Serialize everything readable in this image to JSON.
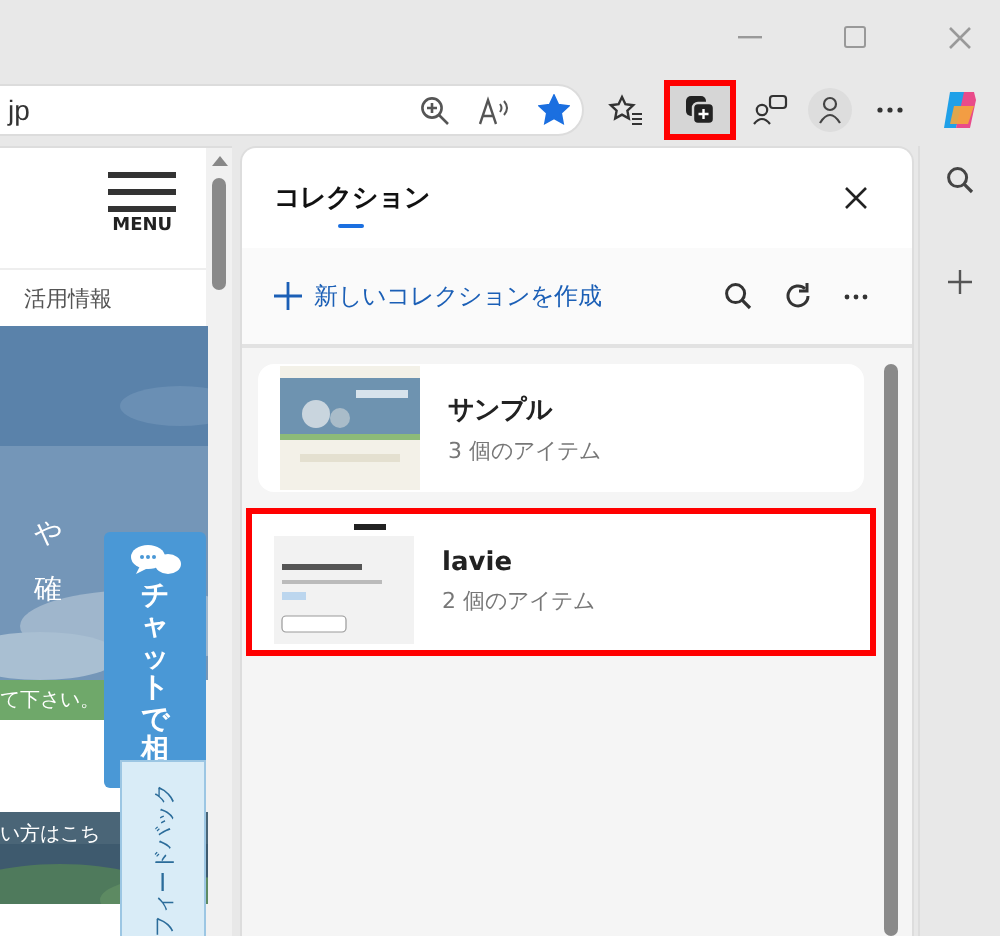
{
  "address_bar": {
    "url": "jp",
    "favorited": true
  },
  "toolbar": {
    "collections_highlighted": true
  },
  "web_page": {
    "menu_label": "MENU",
    "nav_item": "活用情報",
    "hero_lines": [
      "や",
      "確"
    ],
    "banner": "て下さい。",
    "link_band": "い方はこち",
    "chat_tab": "チャットで相",
    "feedback_tab": "フィードバック"
  },
  "collections_panel": {
    "title": "コレクション",
    "new_collection": "新しいコレクションを作成",
    "collections": [
      {
        "name": "サンプル",
        "count": "3 個のアイテム",
        "highlighted": false
      },
      {
        "name": "lavie",
        "count": "2 個のアイテム",
        "highlighted": true
      }
    ]
  }
}
